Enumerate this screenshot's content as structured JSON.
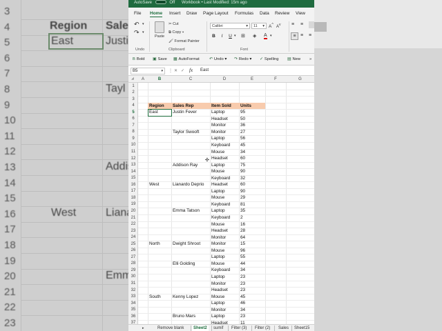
{
  "titlebar": {
    "autosave": "AutoSave",
    "toggle": "Off",
    "title": "Workbook • Last Modified: 15m ago"
  },
  "menu": [
    "File",
    "Home",
    "Insert",
    "Draw",
    "Page Layout",
    "Formulas",
    "Data",
    "Review",
    "View"
  ],
  "menu_active": "Home",
  "ribbon": {
    "undo_label": "Undo",
    "paste": "Paste",
    "cut": "Cut",
    "copy": "Copy",
    "format_painter": "Format Painter",
    "clipboard_label": "Clipboard",
    "font_name": "Calibri",
    "font_size": "11",
    "font_label": "Font",
    "bold": "B",
    "italic": "I",
    "underline": "U"
  },
  "qat": [
    "Bold",
    "Save",
    "AutoFormat",
    "Undo",
    "Redo",
    "Spelling",
    "New"
  ],
  "formula_bar": {
    "name_box": "B5",
    "fx": "fx",
    "value": "East"
  },
  "columns": [
    "A",
    "B",
    "C",
    "D",
    "E",
    "F",
    "G"
  ],
  "selected_column": "B",
  "selected_row": "5",
  "headers": {
    "region": "Region",
    "sales_rep": "Sales Rep",
    "item": "Item Sold",
    "units": "Units"
  },
  "rows": [
    {
      "n": "1",
      "region": "",
      "rep": "",
      "item": "",
      "units": ""
    },
    {
      "n": "2",
      "region": "",
      "rep": "",
      "item": "",
      "units": ""
    },
    {
      "n": "3",
      "region": "",
      "rep": "",
      "item": "",
      "units": ""
    },
    {
      "n": "4",
      "region": "Region",
      "rep": "Sales Rep",
      "item": "Item Sold",
      "units": "Units"
    },
    {
      "n": "5",
      "region": "East",
      "rep": "Justin Fever",
      "item": "Laptop",
      "units": "95"
    },
    {
      "n": "6",
      "region": "",
      "rep": "",
      "item": "Headset",
      "units": "50"
    },
    {
      "n": "7",
      "region": "",
      "rep": "",
      "item": "Monitor",
      "units": "36"
    },
    {
      "n": "8",
      "region": "",
      "rep": "Taylor Swooft",
      "item": "Monitor",
      "units": "27"
    },
    {
      "n": "9",
      "region": "",
      "rep": "",
      "item": "Laptop",
      "units": "56"
    },
    {
      "n": "10",
      "region": "",
      "rep": "",
      "item": "Keyboard",
      "units": "45"
    },
    {
      "n": "11",
      "region": "",
      "rep": "",
      "item": "Mouse",
      "units": "34"
    },
    {
      "n": "12",
      "region": "",
      "rep": "",
      "item": "Headset",
      "units": "60"
    },
    {
      "n": "13",
      "region": "",
      "rep": "Addison Ray",
      "item": "Laptop",
      "units": "75"
    },
    {
      "n": "14",
      "region": "",
      "rep": "",
      "item": "Mouse",
      "units": "90"
    },
    {
      "n": "15",
      "region": "",
      "rep": "",
      "item": "Keyboard",
      "units": "32"
    },
    {
      "n": "16",
      "region": "West",
      "rep": "Lianardo Deprio",
      "item": "Headset",
      "units": "60"
    },
    {
      "n": "17",
      "region": "",
      "rep": "",
      "item": "Laptop",
      "units": "90"
    },
    {
      "n": "18",
      "region": "",
      "rep": "",
      "item": "Mouse",
      "units": "29"
    },
    {
      "n": "19",
      "region": "",
      "rep": "",
      "item": "Keyboard",
      "units": "81"
    },
    {
      "n": "20",
      "region": "",
      "rep": "Emma Tatson",
      "item": "Laptop",
      "units": "35"
    },
    {
      "n": "21",
      "region": "",
      "rep": "",
      "item": "Keyboard",
      "units": "2"
    },
    {
      "n": "22",
      "region": "",
      "rep": "",
      "item": "Mouse",
      "units": "16"
    },
    {
      "n": "23",
      "region": "",
      "rep": "",
      "item": "Headset",
      "units": "28"
    },
    {
      "n": "24",
      "region": "",
      "rep": "",
      "item": "Monitor",
      "units": "64"
    },
    {
      "n": "25",
      "region": "North",
      "rep": "Dwight Shroot",
      "item": "Monitor",
      "units": "15"
    },
    {
      "n": "26",
      "region": "",
      "rep": "",
      "item": "Mouse",
      "units": "96"
    },
    {
      "n": "27",
      "region": "",
      "rep": "",
      "item": "Laptop",
      "units": "55"
    },
    {
      "n": "28",
      "region": "",
      "rep": "Elli Golding",
      "item": "Mouse",
      "units": "44"
    },
    {
      "n": "29",
      "region": "",
      "rep": "",
      "item": "Keyboard",
      "units": "34"
    },
    {
      "n": "30",
      "region": "",
      "rep": "",
      "item": "Laptop",
      "units": "23"
    },
    {
      "n": "31",
      "region": "",
      "rep": "",
      "item": "Monitor",
      "units": "23"
    },
    {
      "n": "32",
      "region": "",
      "rep": "",
      "item": "Headset",
      "units": "23"
    },
    {
      "n": "33",
      "region": "South",
      "rep": "Kenny Lopez",
      "item": "Mouse",
      "units": "45"
    },
    {
      "n": "34",
      "region": "",
      "rep": "",
      "item": "Laptop",
      "units": "46"
    },
    {
      "n": "35",
      "region": "",
      "rep": "",
      "item": "Monitor",
      "units": "34"
    },
    {
      "n": "36",
      "region": "",
      "rep": "Bruno Mars",
      "item": "Laptop",
      "units": "23"
    },
    {
      "n": "37",
      "region": "",
      "rep": "",
      "item": "Headset",
      "units": "11"
    }
  ],
  "sheet_tabs": [
    "Remove blank",
    "Sheet2",
    "sumif",
    "Filter (3)",
    "Filter (2)",
    "Sales",
    "Sheet15"
  ],
  "sheet_active": "Sheet2",
  "background_zoom": {
    "left_rows": [
      "3",
      "4",
      "5",
      "6",
      "7",
      "8",
      "9",
      "10",
      "11",
      "12",
      "13",
      "14",
      "15",
      "16",
      "17",
      "18",
      "19",
      "20",
      "21",
      "22",
      "23"
    ],
    "left_region_header": "Region",
    "left_sales_header": "Sales",
    "left_east": "East",
    "left_justin": "Justi",
    "left_taylor": "Tayl",
    "left_addison": "Addis",
    "left_west": "West",
    "left_lianardo": "Liana",
    "left_emma": "Emm"
  },
  "colors": {
    "accent": "#1a6b3a",
    "header_fill": "#f8cbad",
    "titlebar": "#1f6b3f"
  }
}
